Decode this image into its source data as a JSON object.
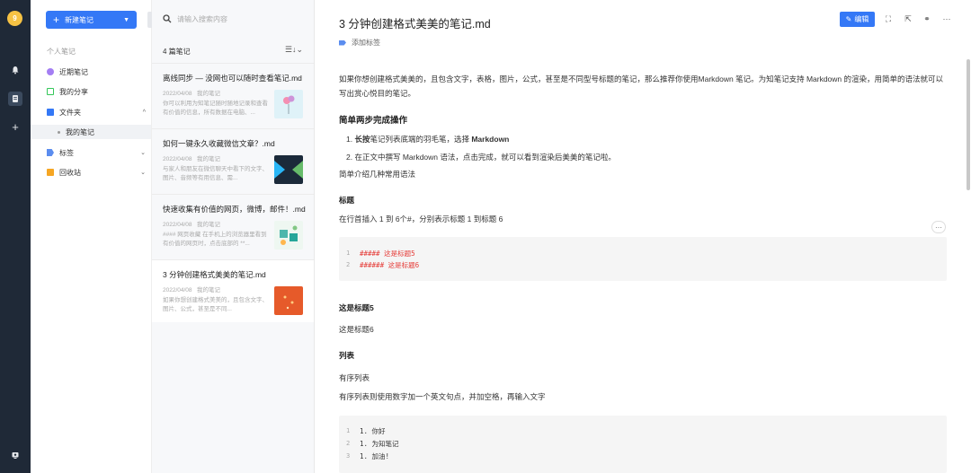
{
  "rail": {
    "avatar_letter": "9"
  },
  "nav": {
    "new_note_label": "新建笔记",
    "section_label": "个人笔记",
    "items": [
      {
        "label": "近期笔记",
        "color": "#a47ef3"
      },
      {
        "label": "我的分享",
        "color": "#34c759"
      },
      {
        "label": "文件夹",
        "color": "#3478f6"
      },
      {
        "label": "标签",
        "color": "#5b8def"
      },
      {
        "label": "回收站",
        "color": "#f6a623"
      }
    ],
    "folder_sub": "我的笔记"
  },
  "list": {
    "search_placeholder": "请输入搜索内容",
    "count_label": "4 篇笔记",
    "cards": [
      {
        "title": "离线同步 — 没网也可以随时查看笔记.md",
        "date": "2022/04/08",
        "folder": "我的笔记",
        "snippet": "你可以利用为知笔记随时随地记录和查看有价值的信息，所有数据在电脑、..."
      },
      {
        "title": "如何一键永久收藏微信文章？.md",
        "date": "2022/04/08",
        "folder": "我的笔记",
        "snippet": "与家人和朋友在微信聊天中看下的文字、图片、音频等有用信息、需..."
      },
      {
        "title": "快速收集有价值的网页，微博，邮件！.md",
        "date": "2022/04/08",
        "folder": "我的笔记",
        "snippet": "#### 网页收藏 在手机上的浏览器里看到有价值的网页时，点击底部的 **..."
      },
      {
        "title": "3 分钟创建格式美美的笔记.md",
        "date": "2022/04/08",
        "folder": "我的笔记",
        "snippet": "如果你想创建格式美美的，且包含文字、图片、公式，甚至是不同..."
      }
    ]
  },
  "editor": {
    "title": "3 分钟创建格式美美的笔记.md",
    "add_tag": "添加标签",
    "edit_label": "编辑",
    "intro": "如果你想创建格式美美的，且包含文字，表格，图片，公式，甚至是不同型号标题的笔记，那么推荐你使用Markdown 笔记。为知笔记支持 Markdown 的渲染，用简单的语法就可以写出赏心悦目的笔记。",
    "h_steps": "简单两步完成操作",
    "step1_bold": "长按",
    "step1_rest": "笔记列表底端的羽毛笔，选择 ",
    "step1_md": "Markdown",
    "step2": "在正文中撰写 Markdown 语法，点击完成，就可以看到渲染后美美的笔记啦。",
    "intro_syntax": "简单介绍几种常用语法",
    "h_title": "标题",
    "title_desc": "在行首插入 1 到 6个#，分别表示标题 1 到标题 6",
    "code1": [
      "##### 这是标题5",
      "###### 这是标题6"
    ],
    "rendered_h5": "这是标题5",
    "rendered_h6": "这是标题6",
    "h_list": "列表",
    "ordered_list": "有序列表",
    "ordered_desc": "有序列表则使用数字加一个英文句点，并加空格，再输入文字",
    "code2": [
      "1. 你好",
      "1. 为知笔记",
      "1. 加油!"
    ],
    "more": "···"
  }
}
